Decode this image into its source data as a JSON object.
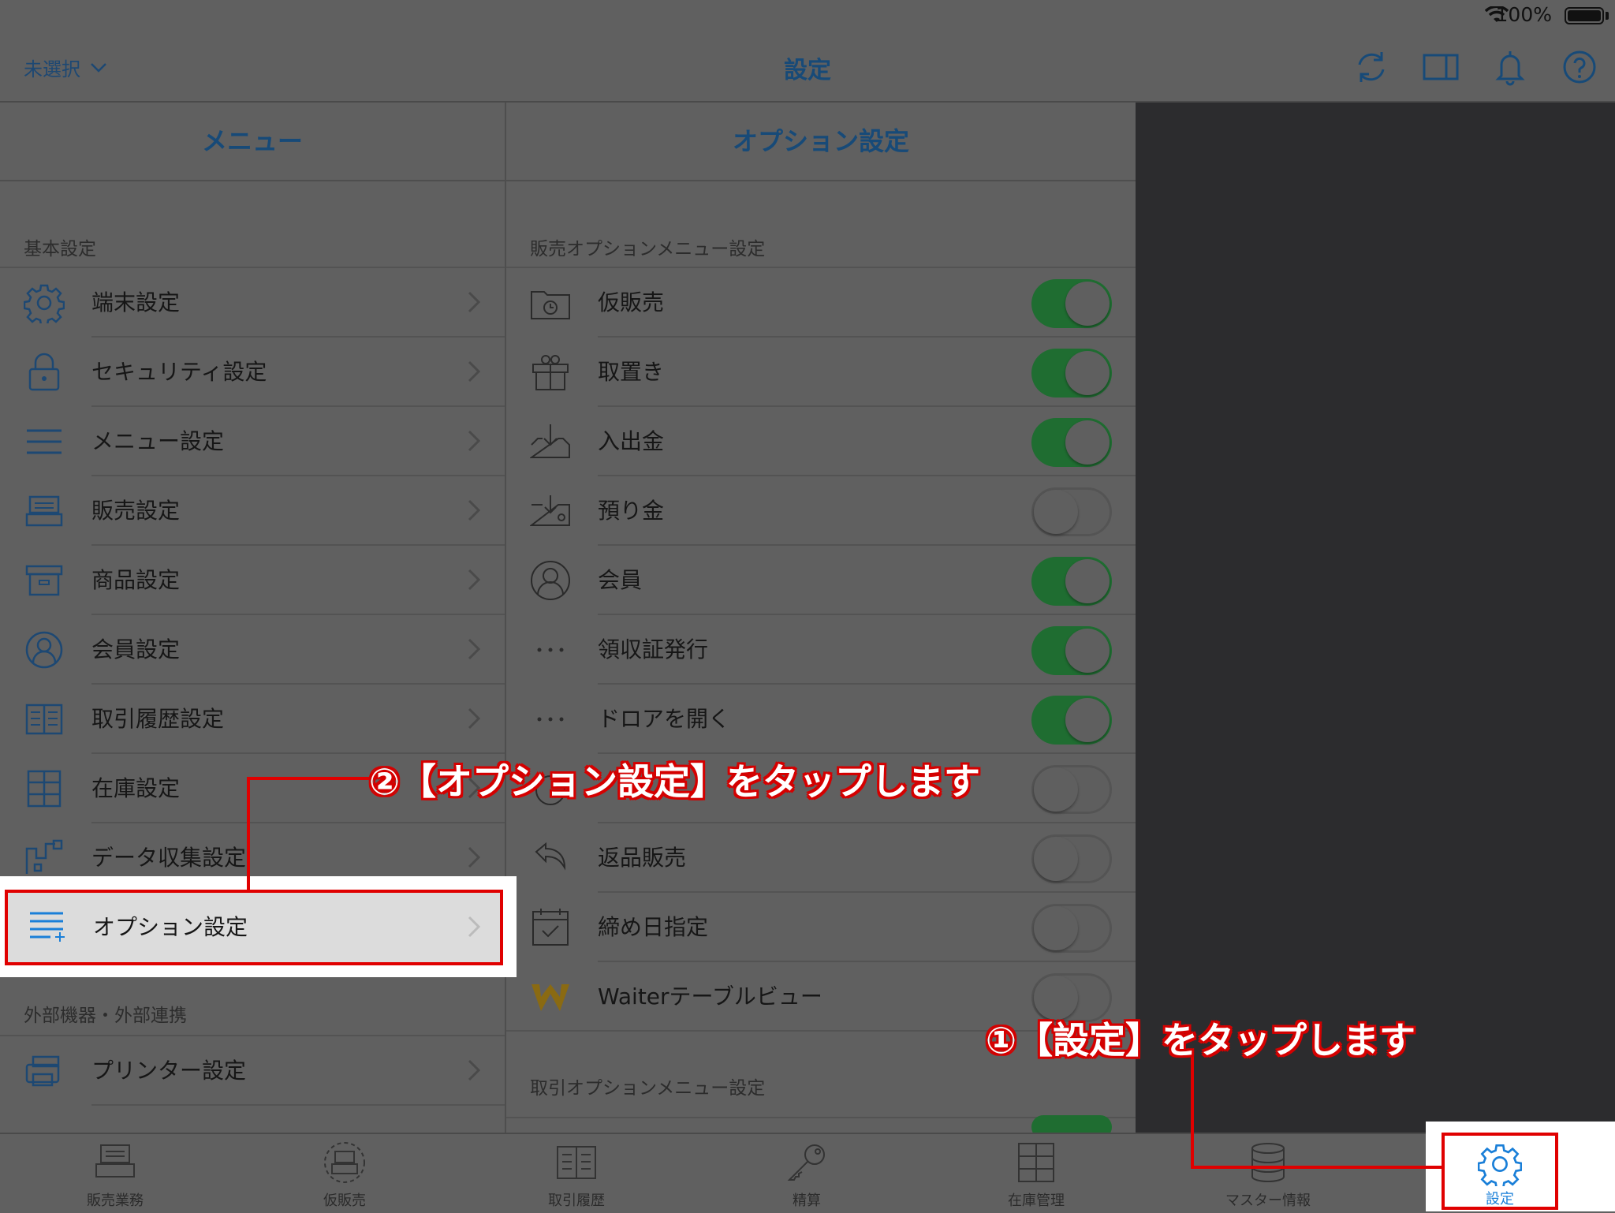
{
  "status": {
    "battery": "100%"
  },
  "nav": {
    "select_label": "未選択",
    "title": "設定"
  },
  "menu": {
    "header": "メニュー",
    "section_basic": "基本設定",
    "items": [
      {
        "label": "端末設定",
        "icon": "gear-icon"
      },
      {
        "label": "セキュリティ設定",
        "icon": "lock-icon"
      },
      {
        "label": "メニュー設定",
        "icon": "list-icon"
      },
      {
        "label": "販売設定",
        "icon": "register-icon"
      },
      {
        "label": "商品設定",
        "icon": "box-icon"
      },
      {
        "label": "会員設定",
        "icon": "person-icon"
      },
      {
        "label": "取引履歴設定",
        "icon": "book-icon"
      },
      {
        "label": "在庫設定",
        "icon": "shelves-icon"
      },
      {
        "label": "データ収集設定",
        "icon": "data-icon"
      },
      {
        "label": "オプション設定",
        "icon": "list-plus-icon"
      }
    ],
    "section_external": "外部機器・外部連携",
    "external_items": [
      {
        "label": "プリンター設定",
        "icon": "printer-icon"
      }
    ]
  },
  "options": {
    "header": "オプション設定",
    "section_sales": "販売オプションメニュー設定",
    "items": [
      {
        "label": "仮販売",
        "on": true
      },
      {
        "label": "取置き",
        "on": true
      },
      {
        "label": "入出金",
        "on": true
      },
      {
        "label": "預り金",
        "on": false
      },
      {
        "label": "会員",
        "on": true
      },
      {
        "label": "領収証発行",
        "on": true
      },
      {
        "label": "ドロアを開く",
        "on": true
      },
      {
        "label": "",
        "on": false
      },
      {
        "label": "返品販売",
        "on": false
      },
      {
        "label": "締め日指定",
        "on": false
      },
      {
        "label": "Waiterテーブルビュー",
        "on": false
      }
    ],
    "section_transaction": "取引オプションメニュー設定"
  },
  "tabs": [
    {
      "label": "販売業務",
      "icon": "register-icon"
    },
    {
      "label": "仮販売",
      "icon": "temp-sale-icon"
    },
    {
      "label": "取引履歴",
      "icon": "book-icon"
    },
    {
      "label": "精算",
      "icon": "key-icon"
    },
    {
      "label": "在庫管理",
      "icon": "shelves-icon"
    },
    {
      "label": "マスター情報",
      "icon": "database-icon"
    },
    {
      "label": "設定",
      "icon": "gear-icon"
    }
  ],
  "annotations": {
    "step1": "①【設定】をタップします",
    "step2": "②【オプション設定】をタップします"
  },
  "colors": {
    "accent": "#1a7fd8",
    "toggle_on": "#1f6d31",
    "annotation_red": "#e00000"
  }
}
